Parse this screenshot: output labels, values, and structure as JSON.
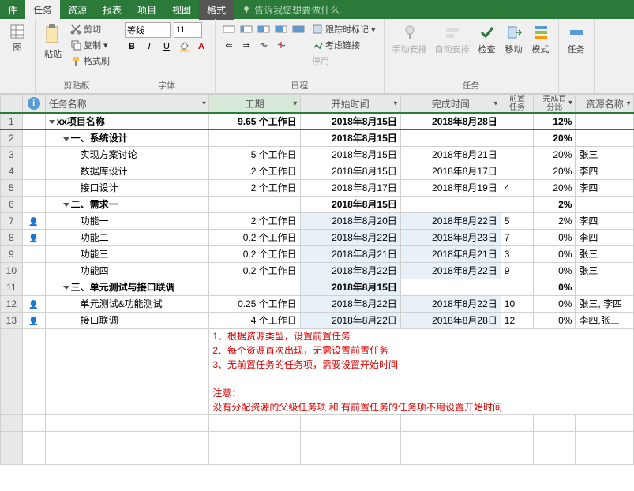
{
  "menu": {
    "file": "件",
    "task": "任务",
    "resource": "资源",
    "report": "报表",
    "project": "项目",
    "view": "视图",
    "format": "格式",
    "tellme": "告诉我您想要做什么..."
  },
  "ribbon": {
    "clipboard": {
      "label": "剪贴板",
      "chart": "图",
      "paste": "粘贴",
      "cut": "剪切",
      "copy": "复制",
      "painter": "格式刷"
    },
    "font": {
      "label": "字体",
      "name": "等线",
      "size": "11",
      "bold": "B",
      "italic": "I",
      "underline": "U"
    },
    "schedule": {
      "label": "日程",
      "track": "跟踪时标记",
      "link": "考虑链接",
      "pause": "停用"
    },
    "tasks": {
      "label": "任务",
      "manual": "手动安排",
      "auto": "自动安排",
      "check": "检查",
      "move": "移动",
      "mode": "模式"
    },
    "insert": {
      "task": "任务"
    }
  },
  "columns": {
    "name": "任务名称",
    "duration": "工期",
    "start": "开始时间",
    "finish": "完成时间",
    "pred": "前置\n任务",
    "pct": "完成百分比",
    "res": "资源名称"
  },
  "rows": [
    {
      "n": "1",
      "flag": "",
      "lvl": 0,
      "sum": true,
      "name": "xx项目名称",
      "dur": "9.65 个工作日",
      "start": "2018年8月15日",
      "finish": "2018年8月28日",
      "pred": "",
      "pct": "12%",
      "res": ""
    },
    {
      "n": "2",
      "flag": "",
      "lvl": 1,
      "sum": true,
      "name": "一、系统设计",
      "dur": "",
      "start": "2018年8月15日",
      "finish": "",
      "pred": "",
      "pct": "20%",
      "res": ""
    },
    {
      "n": "3",
      "flag": "",
      "lvl": 2,
      "sum": false,
      "name": "实现方案讨论",
      "dur": "5 个工作日",
      "start": "2018年8月15日",
      "finish": "2018年8月21日",
      "pred": "",
      "pct": "20%",
      "res": "张三"
    },
    {
      "n": "4",
      "flag": "",
      "lvl": 2,
      "sum": false,
      "name": "数据库设计",
      "dur": "2 个工作日",
      "start": "2018年8月15日",
      "finish": "2018年8月17日",
      "pred": "",
      "pct": "20%",
      "res": "李四"
    },
    {
      "n": "5",
      "flag": "",
      "lvl": 2,
      "sum": false,
      "name": "接口设计",
      "dur": "2 个工作日",
      "start": "2018年8月17日",
      "finish": "2018年8月19日",
      "pred": "4",
      "pct": "20%",
      "res": "李四"
    },
    {
      "n": "6",
      "flag": "",
      "lvl": 1,
      "sum": true,
      "name": "二、需求一",
      "dur": "",
      "start": "2018年8月15日",
      "finish": "",
      "pred": "",
      "pct": "2%",
      "res": ""
    },
    {
      "n": "7",
      "flag": "●",
      "lvl": 2,
      "sum": false,
      "name": "功能一",
      "dur": "2 个工作日",
      "start": "2018年8月20日",
      "finish": "2018年8月22日",
      "pred": "5",
      "pct": "2%",
      "res": "李四"
    },
    {
      "n": "8",
      "flag": "●",
      "lvl": 2,
      "sum": false,
      "name": "功能二",
      "dur": "0.2 个工作日",
      "start": "2018年8月22日",
      "finish": "2018年8月23日",
      "pred": "7",
      "pct": "0%",
      "res": "李四"
    },
    {
      "n": "9",
      "flag": "",
      "lvl": 2,
      "sum": false,
      "name": "功能三",
      "dur": "0.2 个工作日",
      "start": "2018年8月21日",
      "finish": "2018年8月21日",
      "pred": "3",
      "pct": "0%",
      "res": "张三"
    },
    {
      "n": "10",
      "flag": "",
      "lvl": 2,
      "sum": false,
      "name": "功能四",
      "dur": "0.2 个工作日",
      "start": "2018年8月22日",
      "finish": "2018年8月22日",
      "pred": "9",
      "pct": "0%",
      "res": "张三"
    },
    {
      "n": "11",
      "flag": "",
      "lvl": 1,
      "sum": true,
      "name": "三、单元测试与接口联调",
      "dur": "",
      "start": "2018年8月15日",
      "finish": "",
      "pred": "",
      "pct": "0%",
      "res": ""
    },
    {
      "n": "12",
      "flag": "●",
      "lvl": 2,
      "sum": false,
      "name": "单元测试&功能测试",
      "dur": "0.25 个工作日",
      "start": "2018年8月22日",
      "finish": "2018年8月22日",
      "pred": "10",
      "pct": "0%",
      "res": "张三, 李四"
    },
    {
      "n": "13",
      "flag": "●",
      "lvl": 2,
      "sum": false,
      "name": "接口联调",
      "dur": "4 个工作日",
      "start": "2018年8月22日",
      "finish": "2018年8月28日",
      "pred": "12",
      "pct": "0%",
      "res": "李四,张三"
    }
  ],
  "notes": {
    "l1": "1、根据资源类型，设置前置任务",
    "l2": "2、每个资源首次出现，无需设置前置任务",
    "l3": "3、无前置任务的任务项，需要设置开始时间",
    "warn": "注意：",
    "l4": "没有分配资源的父级任务项  和 有前置任务的任务项不用设置开始时间"
  }
}
